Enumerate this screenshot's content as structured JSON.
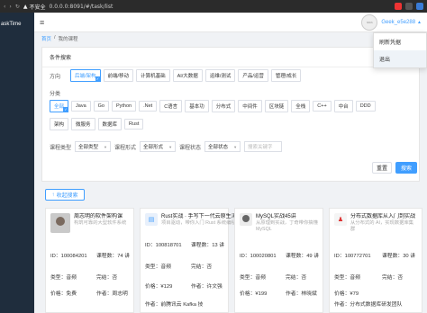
{
  "browser": {
    "security": "不安全",
    "url": "0.0.0.0:8091/#/task/list"
  },
  "sidebar": {
    "brand": "askTime"
  },
  "header": {
    "avatar_text": "hhhh",
    "user_name": "Geek_e5e288"
  },
  "dropdown": {
    "items": [
      "刷新凭据",
      "退出"
    ]
  },
  "breadcrumb": {
    "home": "首页",
    "sep": "/",
    "current": "我的课程"
  },
  "panel": {
    "title": "条件搜索",
    "direction_label": "方向",
    "directions": [
      "后端/架构",
      "前端/移动",
      "计算机基础",
      "AI/大数据",
      "运维/测试",
      "产品/运营",
      "管理/成长"
    ],
    "category_label": "分类",
    "categories_row1": [
      "全部",
      "Java",
      "Go",
      "Python",
      ".Net",
      "C语言",
      "基本功",
      "分布式",
      "中间件",
      "区块链",
      "全栈",
      "C++",
      "中台",
      "DDD"
    ],
    "categories_row2": [
      "架构",
      "微服务",
      "数据库",
      "Rust"
    ],
    "course_type_label": "课程类型",
    "course_type_value": "全部类型",
    "course_form_label": "课程形式",
    "course_form_value": "全部形式",
    "course_status_label": "课程状态",
    "course_status_value": "全部状态",
    "keyword_placeholder": "搜索关键字",
    "reset_label": "重置",
    "search_label": "搜索"
  },
  "collapse_label": "收起搜索",
  "cards": [
    {
      "title": "周志明的软件架构课",
      "desc": "构筑可靠的大型软件系统",
      "id_label": "ID：",
      "id": "100084201",
      "lessons_label": "课程数：",
      "lessons": "74 讲",
      "type_label": "类型：",
      "type": "音频",
      "done_label": "完结：",
      "done": "否",
      "price_label": "价格：",
      "price": "免费",
      "author_label": "作者：",
      "author": "周志明"
    },
    {
      "title": "Rust实战 · 手写下一代云原生消息队列",
      "desc": "项目驱动，带你入门 Rust 系统编程",
      "id_label": "ID：",
      "id": "100818701",
      "lessons_label": "课程数：",
      "lessons": "13 讲",
      "type_label": "类型：",
      "type": "音频",
      "done_label": "完结：",
      "done": "否",
      "price_label": "价格：",
      "price": "¥129",
      "author_label": "作者：",
      "author": "许文强"
    },
    {
      "title": "MySQL实战45讲",
      "desc": "从原理到实战，丁奇带你搞懂MySQL",
      "id_label": "ID：",
      "id": "100020801",
      "lessons_label": "课程数：",
      "lessons": "49 讲",
      "type_label": "类型：",
      "type": "音频",
      "done_label": "完结：",
      "done": "否",
      "price_label": "价格：",
      "price": "¥199",
      "author_label": "作者：",
      "author": "林晓斌"
    },
    {
      "title": "分布式数据库从入门到实战",
      "desc": "从分布式的 AI，实现数据库集群",
      "id_label": "ID：",
      "id": "100772701",
      "lessons_label": "课程数：",
      "lessons": "30 讲",
      "type_label": "类型：",
      "type": "音频",
      "done_label": "完结：",
      "done": "否",
      "price_label": "价格：",
      "price": "¥79",
      "author_label": "作者：",
      "author": "分布式数据库研发团队"
    }
  ],
  "card4_partial_author": "作者：前腾讯云 Kafka 技",
  "colors": {
    "primary": "#409eff",
    "sidebar": "#1f2d3d"
  }
}
